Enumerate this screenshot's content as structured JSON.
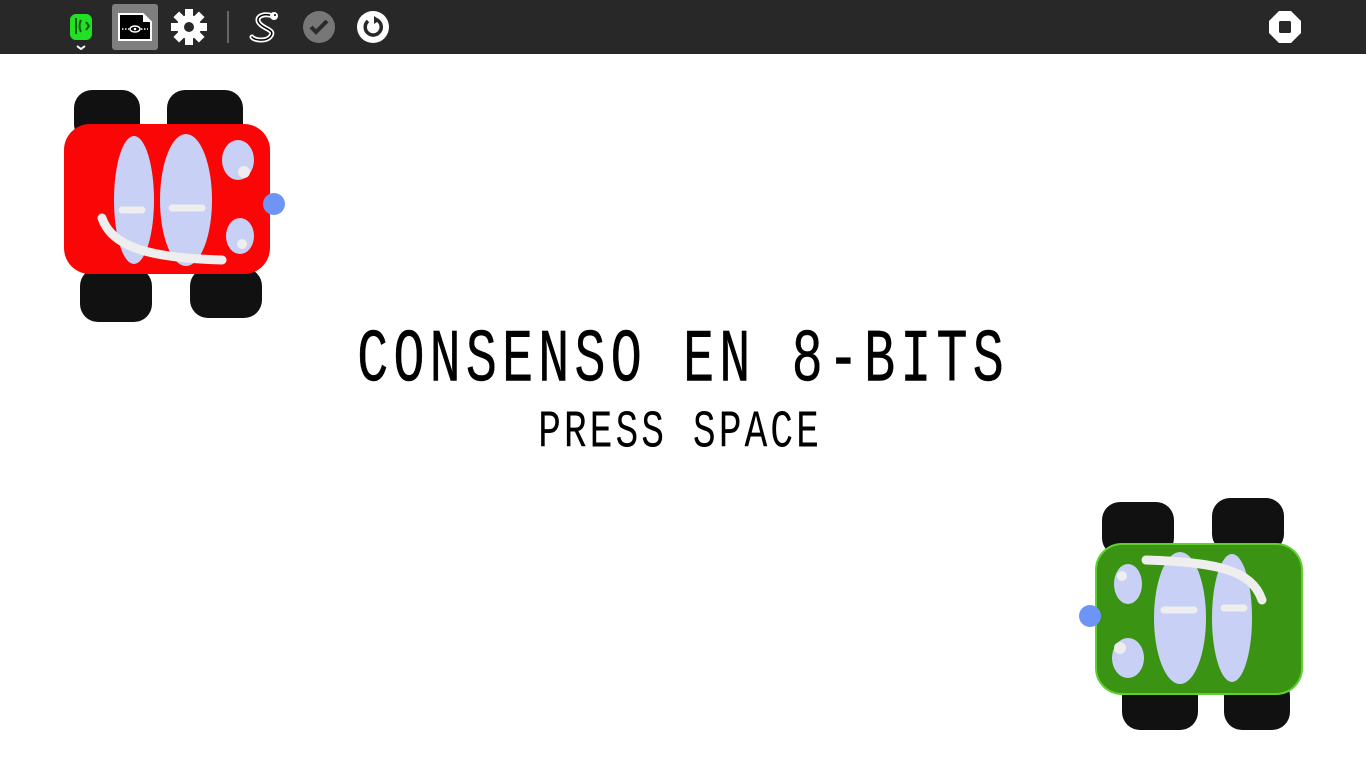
{
  "toolbar": {
    "icons": [
      "app-logo-icon",
      "presentation-mode-icon",
      "settings-gear-icon",
      "python-snake-icon",
      "check-icon",
      "restart-icon",
      "stop-icon"
    ]
  },
  "game": {
    "title": "CONSENSO EN 8-BITS",
    "prompt": "PRESS SPACE"
  },
  "colors": {
    "toolbar_bg": "#282828",
    "red_car": "#fb0606",
    "green_car": "#3b9314",
    "windows": "#c8d0f5",
    "tires": "#111111",
    "headlight": "#6e94f5"
  }
}
